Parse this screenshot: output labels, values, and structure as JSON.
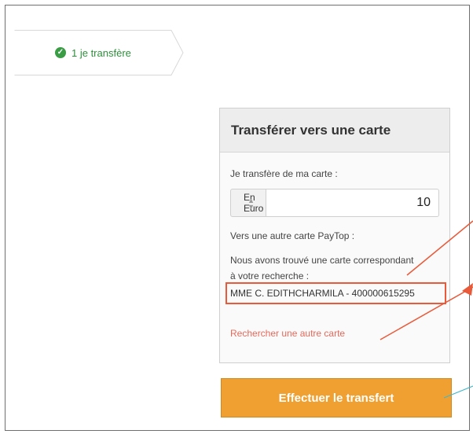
{
  "steps": [
    {
      "label": "1 je transfère",
      "status": "done"
    }
  ],
  "panel": {
    "title": "Transférer vers une carte",
    "from_label": "Je transfère de ma carte :",
    "currency_selected": "En Euro",
    "amount_value": "10",
    "to_label": "Vers une autre carte PayTop :",
    "found_text": "Nous avons trouvé une carte correspondant à votre recherche :",
    "card_result": "MME C. EDITHCHARMILA - 400000615295",
    "search_again_link": "Rechercher une autre carte"
  },
  "actions": {
    "submit_label": "Effectuer le transfert"
  },
  "colors": {
    "step_green": "#3a9d46",
    "button_orange": "#f0a030",
    "link_red": "#e46a5c",
    "annotation_red": "#e85a3a",
    "annotation_teal": "#3fb8c9"
  }
}
